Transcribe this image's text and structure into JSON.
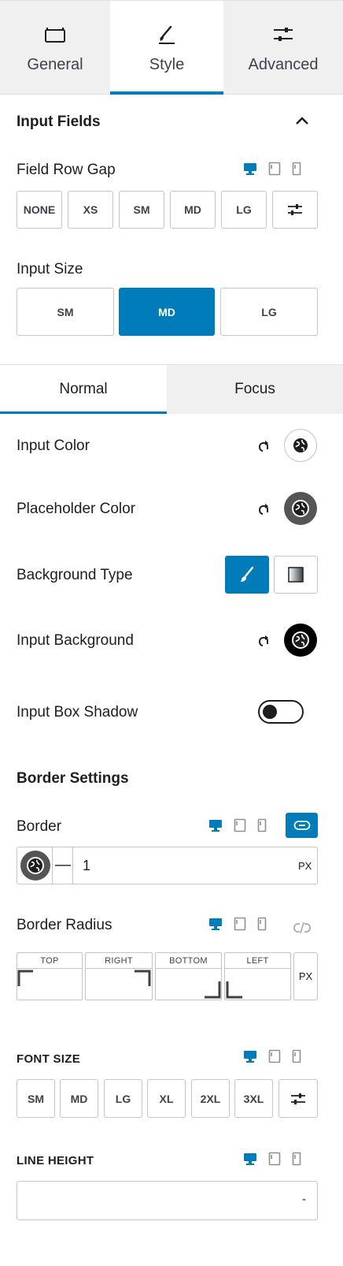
{
  "tabs": [
    {
      "label": "General",
      "icon": "briefcase-icon"
    },
    {
      "label": "Style",
      "icon": "brush-icon"
    },
    {
      "label": "Advanced",
      "icon": "sliders-icon"
    }
  ],
  "active_tab": "Style",
  "section": {
    "title": "Input Fields",
    "collapse_icon": "chevron-up-icon"
  },
  "field_row_gap": {
    "label": "Field Row Gap",
    "options": [
      "NONE",
      "XS",
      "SM",
      "MD",
      "LG"
    ],
    "custom_icon": "sliders-icon"
  },
  "input_size": {
    "label": "Input Size",
    "options": [
      "SM",
      "MD",
      "LG"
    ],
    "selected": "MD"
  },
  "state_tabs": [
    "Normal",
    "Focus"
  ],
  "active_state_tab": "Normal",
  "colors": {
    "accent": "#007cba",
    "input_color_label": "Input Color",
    "placeholder_color_label": "Placeholder Color",
    "input_background_label": "Input Background"
  },
  "background_type": {
    "label": "Background Type",
    "options": [
      "brush-icon",
      "gradient-icon"
    ],
    "selected": "brush-icon"
  },
  "box_shadow": {
    "label": "Input Box Shadow",
    "enabled": false
  },
  "border_settings": {
    "title": "Border Settings",
    "border": {
      "label": "Border",
      "style_symbol": "—",
      "width": "1",
      "unit": "PX"
    },
    "radius": {
      "label": "Border Radius",
      "corners": [
        "TOP",
        "RIGHT",
        "BOTTOM",
        "LEFT"
      ],
      "unit": "PX"
    }
  },
  "font_size": {
    "label": "FONT SIZE",
    "options": [
      "SM",
      "MD",
      "LG",
      "XL",
      "2XL",
      "3XL"
    ],
    "custom_icon": "sliders-icon"
  },
  "line_height": {
    "label": "LINE HEIGHT",
    "value": "-"
  }
}
